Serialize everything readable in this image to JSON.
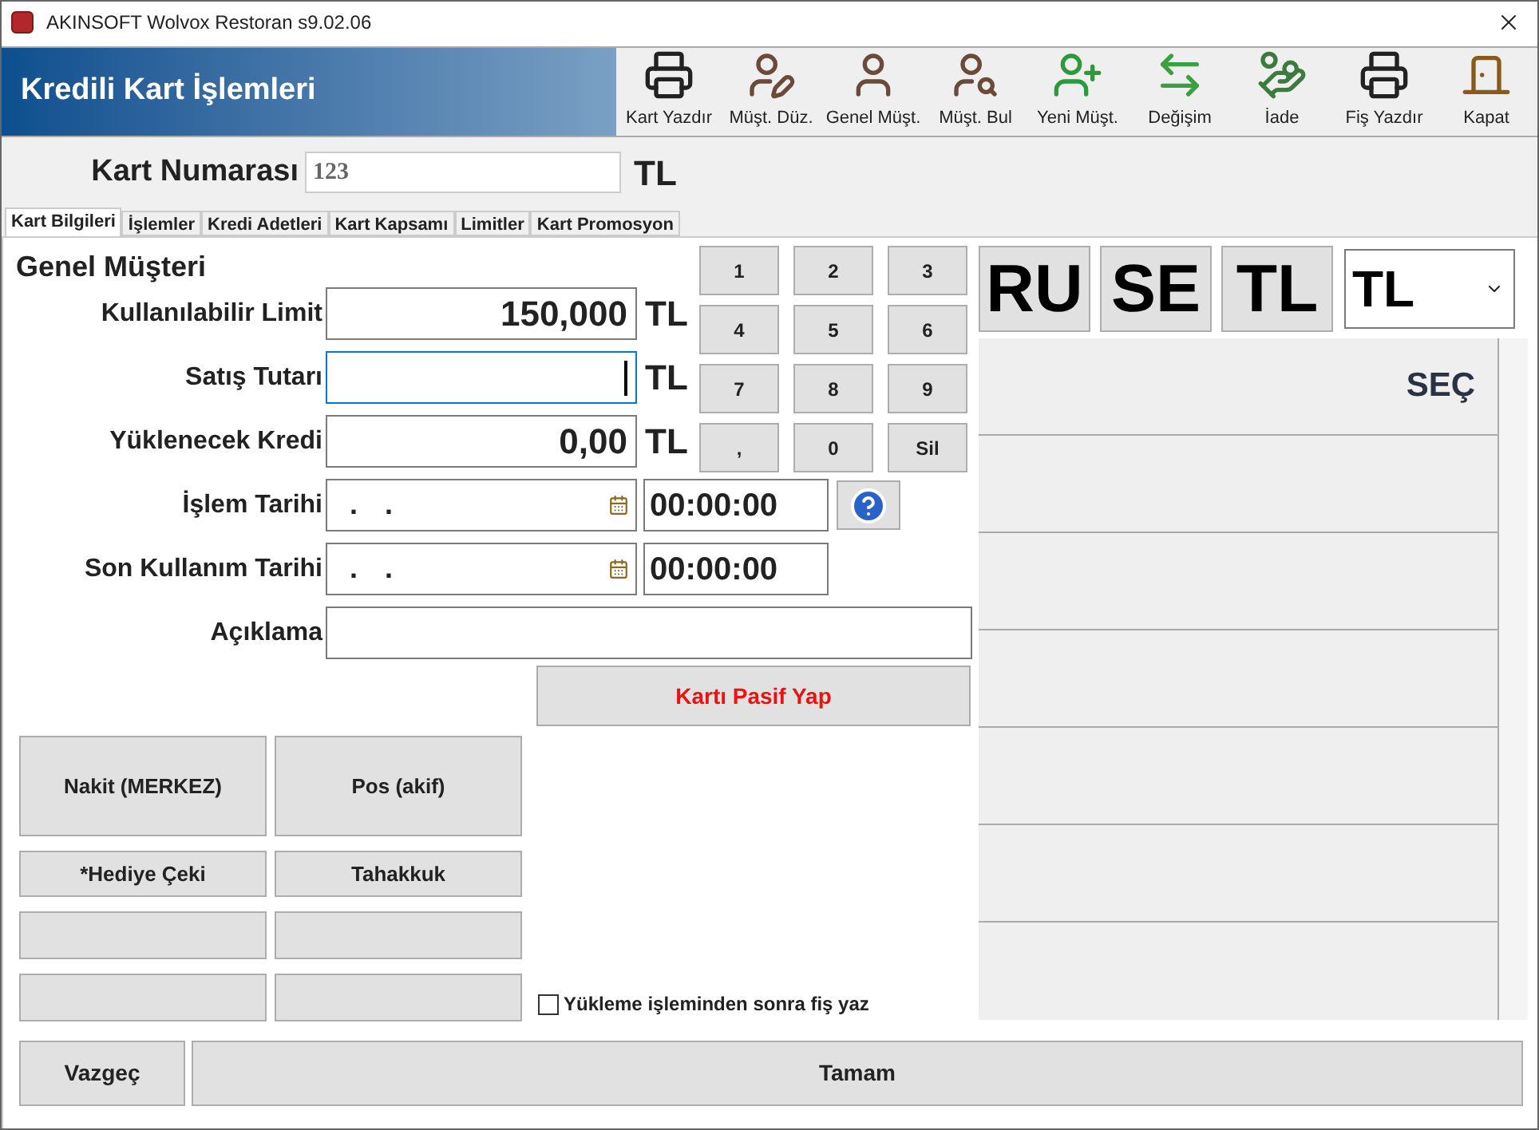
{
  "window": {
    "title": "AKINSOFT Wolvox Restoran s9.02.06"
  },
  "header": {
    "title": "Kredili Kart İşlemleri"
  },
  "toolbar": [
    {
      "label": "Kart Yazdır",
      "kind": "printer"
    },
    {
      "label": "Müşt. Düz.",
      "kind": "user-edit"
    },
    {
      "label": "Genel Müşt.",
      "kind": "user"
    },
    {
      "label": "Müşt. Bul",
      "kind": "user-search"
    },
    {
      "label": "Yeni Müşt.",
      "kind": "user-add"
    },
    {
      "label": "Değişim",
      "kind": "exchange"
    },
    {
      "label": "İade",
      "kind": "refund"
    },
    {
      "label": "Fiş Yazdır",
      "kind": "printer"
    },
    {
      "label": "Kapat",
      "kind": "exit"
    }
  ],
  "card_number": {
    "label": "Kart Numarası",
    "value": "123",
    "currency": "TL"
  },
  "tabs": [
    {
      "label": "Kart Bilgileri",
      "selected": true
    },
    {
      "label": "İşlemler",
      "selected": false
    },
    {
      "label": "Kredi Adetleri",
      "selected": false
    },
    {
      "label": "Kart Kapsamı",
      "selected": false
    },
    {
      "label": "Limitler",
      "selected": false
    },
    {
      "label": "Kart Promosyon",
      "selected": false
    }
  ],
  "customer": "Genel Müşteri",
  "amounts": [
    {
      "label": "Kullanılabilir Limit",
      "value": "150,000",
      "unit": "TL",
      "focused": false
    },
    {
      "label": "Satış Tutarı",
      "unit": "TL",
      "focused": true
    },
    {
      "label": "Yüklenecek Kredi",
      "value": "0,00",
      "unit": "TL",
      "focused": false
    }
  ],
  "keypad": [
    "1",
    "2",
    "3",
    "4",
    "5",
    "6",
    "7",
    "8",
    "9",
    ",",
    "0",
    "Sil"
  ],
  "dates": [
    {
      "label": "İşlem Tarihi",
      "date": ". .",
      "time": "00:00:00",
      "help": true
    },
    {
      "label": "Son Kullanım Tarihi",
      "date": ". .",
      "time": "00:00:00",
      "help": false
    }
  ],
  "description": {
    "label": "Açıklama"
  },
  "deactivate_button": "Kartı Pasif Yap",
  "payment_buttons": [
    {
      "kind": "large",
      "label": "Nakit (MERKEZ)"
    },
    {
      "kind": "large",
      "label": "Pos (akif)"
    },
    {
      "kind": "small",
      "label": "*Hediye Çeki"
    },
    {
      "kind": "small",
      "label": "Tahakkuk"
    },
    {
      "kind": "empty"
    },
    {
      "kind": "empty"
    },
    {
      "kind": "empty"
    },
    {
      "kind": "empty"
    }
  ],
  "print_after_load": {
    "label": "Yükleme işleminden sonra fiş yaz",
    "checked": false
  },
  "currencies": [
    {
      "label": "RU"
    },
    {
      "label": "SE"
    },
    {
      "label": "TL"
    }
  ],
  "currency_select": {
    "value": "TL"
  },
  "list": {
    "action": "SEÇ"
  },
  "footer": {
    "cancel": "Vazgeç",
    "ok": "Tamam"
  }
}
